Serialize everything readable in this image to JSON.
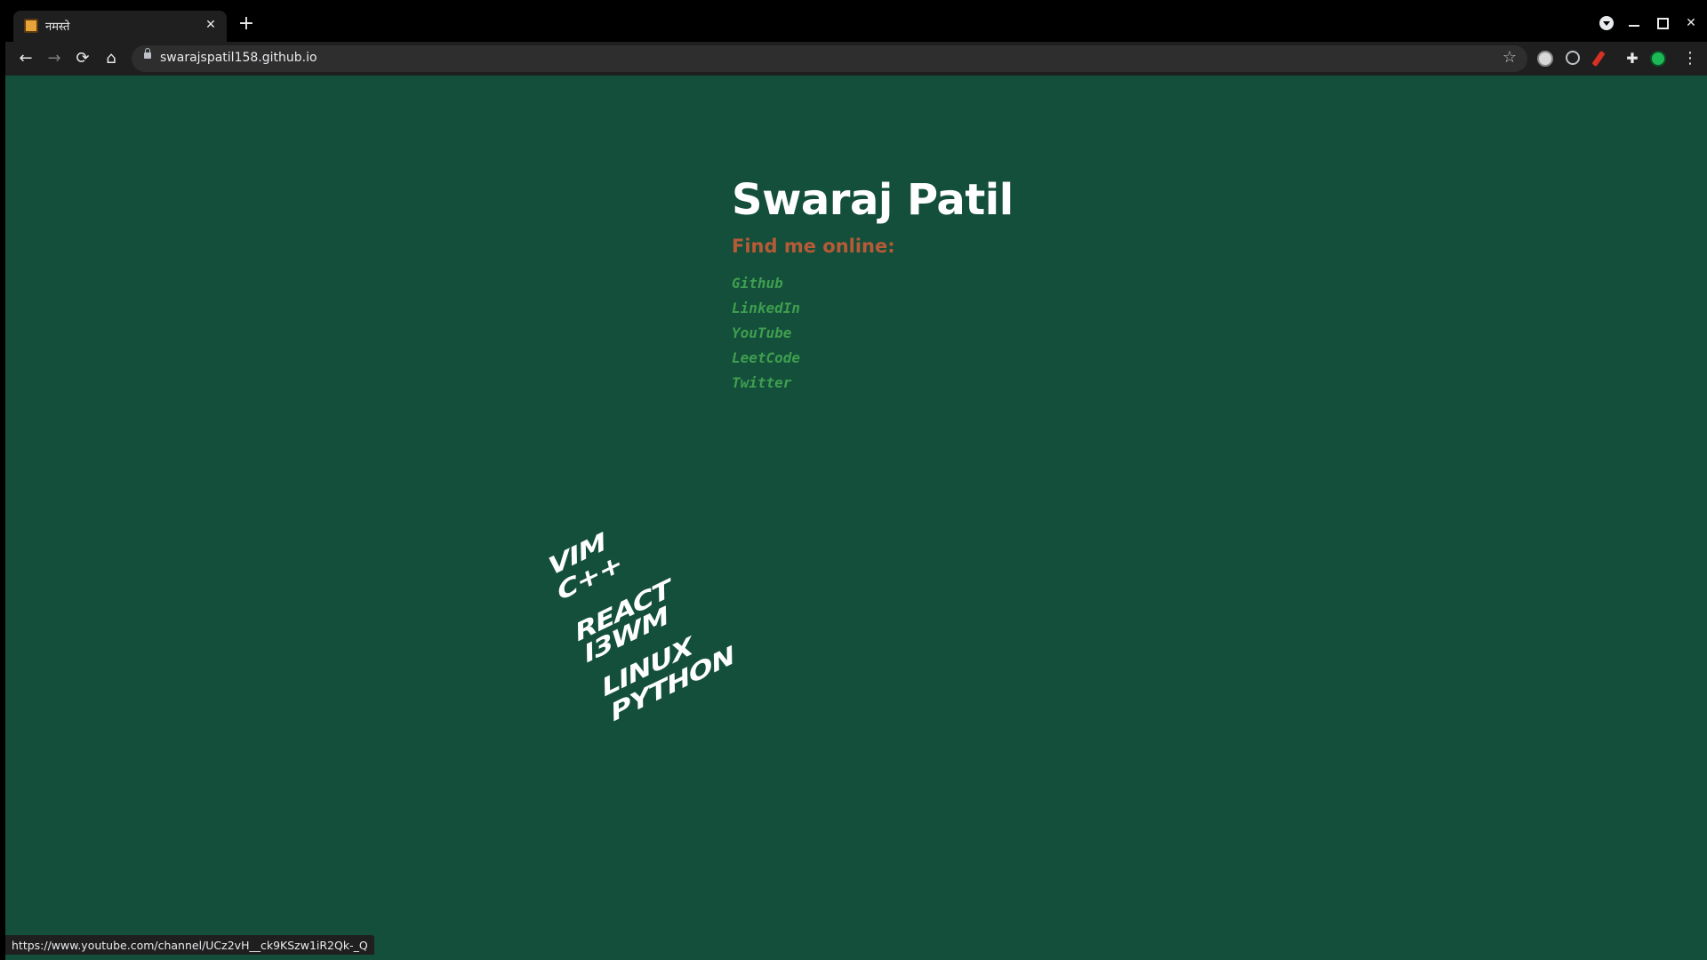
{
  "browser": {
    "tab": {
      "title": "नमस्ते",
      "favicon": "page-favicon",
      "close_label": "✕"
    },
    "new_tab_label": "+",
    "url": "swarajspatil158.github.io",
    "status_url": "https://www.youtube.com/channel/UCz2vH__ck9KSzw1iR2Qk-_Q",
    "icons": {
      "back": "←",
      "forward": "→",
      "reload": "⟳",
      "home": "⌂",
      "star": "☆",
      "menu": "⋮",
      "close": "✕"
    }
  },
  "page": {
    "name": "Swaraj Patil",
    "subtitle": "Find me online:",
    "links": [
      {
        "label": "Github"
      },
      {
        "label": "LinkedIn"
      },
      {
        "label": "YouTube"
      },
      {
        "label": "LeetCode"
      },
      {
        "label": "Twitter"
      }
    ],
    "skills": [
      "VIM",
      "C++",
      "REACT",
      "I3WM",
      "LINUX",
      "PYTHON"
    ]
  },
  "colors": {
    "background": "#134f3a",
    "name": "#ffffff",
    "subtitle": "#b75a37",
    "link": "#3f9e4f",
    "skills_text": "#ffffff"
  }
}
